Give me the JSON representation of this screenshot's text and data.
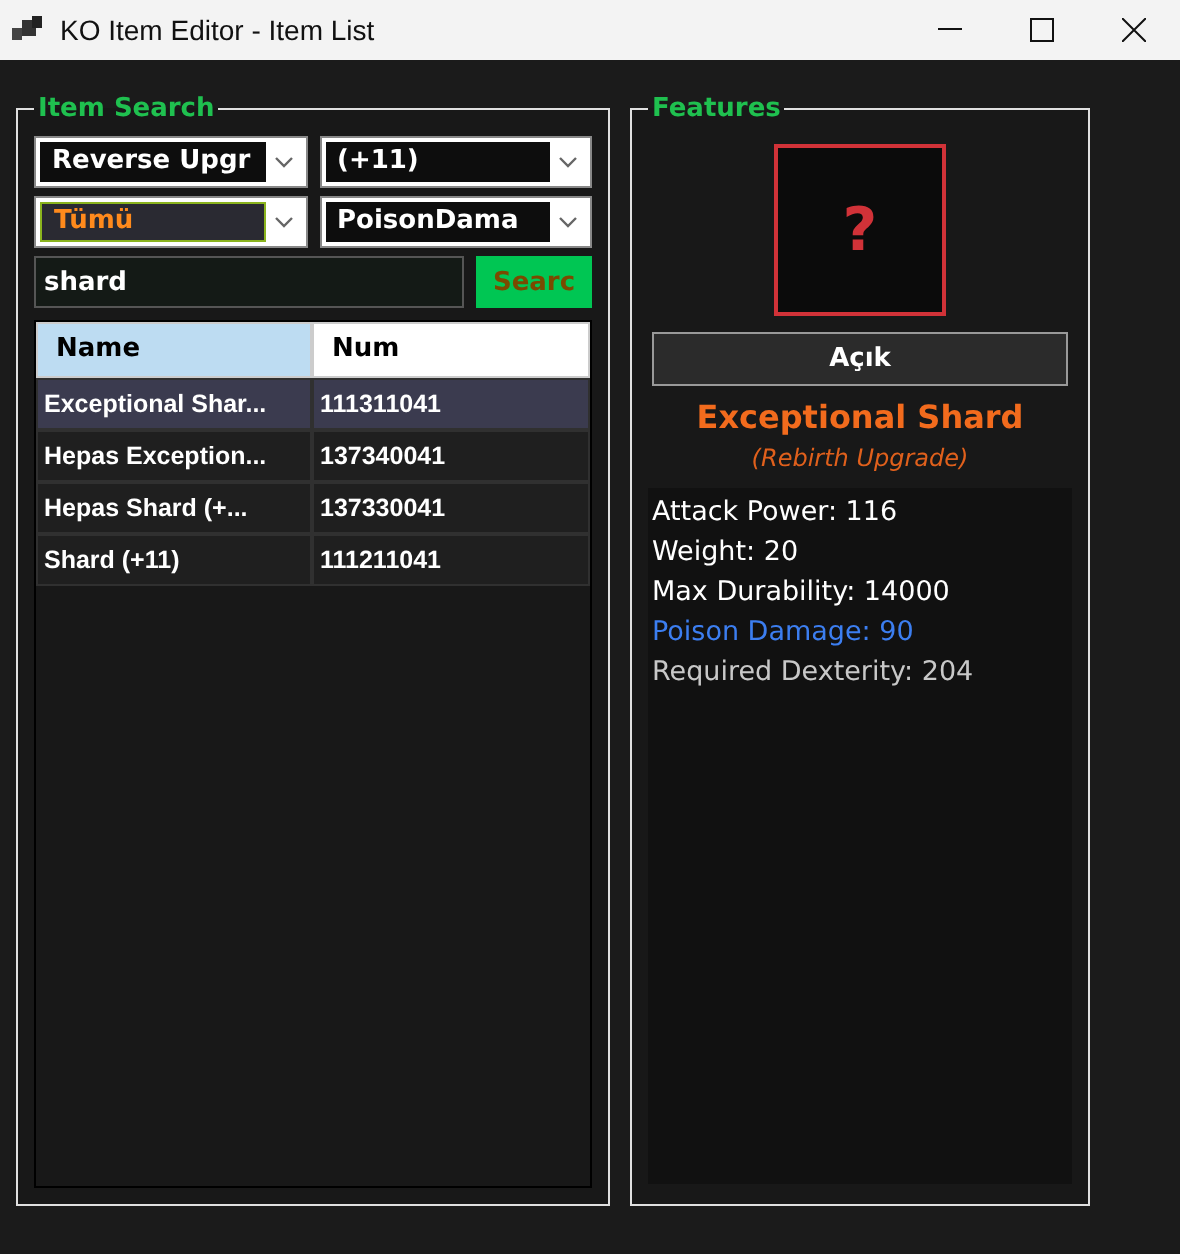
{
  "window": {
    "title": "KO Item Editor - Item List"
  },
  "search_panel": {
    "title": "Item Search",
    "combos": [
      {
        "value": "Reverse Upgr",
        "focused": false
      },
      {
        "value": "(+11)",
        "focused": false
      },
      {
        "value": "Tümü",
        "focused": true
      },
      {
        "value": "PoisonDama",
        "focused": false
      }
    ],
    "search_field": {
      "value": "shard"
    },
    "search_button": "Searc",
    "table": {
      "columns": [
        "Name",
        "Num"
      ],
      "rows": [
        {
          "cells": [
            "Exceptional Shar...",
            "111311041"
          ],
          "selected": true
        },
        {
          "cells": [
            "Hepas Exception...",
            "137340041"
          ],
          "selected": false
        },
        {
          "cells": [
            "Hepas Shard (+...",
            "137330041"
          ],
          "selected": false
        },
        {
          "cells": [
            "Shard (+11)",
            "111211041"
          ],
          "selected": false
        }
      ]
    }
  },
  "features_panel": {
    "title": "Features",
    "image_placeholder": "?",
    "button": "Açık",
    "item_name": "Exceptional Shard",
    "item_subtitle": "(Rebirth Upgrade)",
    "stats": [
      {
        "text": "Attack Power: 116",
        "color": "#ffffff"
      },
      {
        "text": "Weight: 20",
        "color": "#ffffff"
      },
      {
        "text": "Max Durability: 14000",
        "color": "#ffffff"
      },
      {
        "text": "Poison Damage: 90",
        "color": "#3c7ef0"
      },
      {
        "text": "Required Dexterity: 204",
        "color": "#c8c8c8"
      }
    ]
  }
}
